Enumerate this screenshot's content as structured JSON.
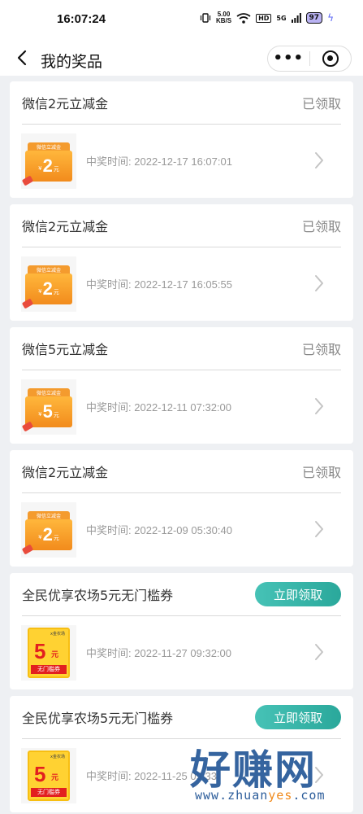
{
  "status_bar": {
    "time": "16:07:24",
    "net_speed_value": "5.00",
    "net_speed_unit": "KB/S",
    "hd": "HD",
    "signal": "5G",
    "battery": "97"
  },
  "nav": {
    "title": "我的奖品",
    "back_icon": "chevron-left-icon",
    "more_icon": "more-dots-icon",
    "close_icon": "target-close-icon"
  },
  "prizes": [
    {
      "name": "微信2元立减金",
      "status": "已领取",
      "action": null,
      "time_label": "中奖时间:",
      "time": "2022-12-17 16:07:01",
      "coupon": {
        "type": "cash",
        "header": "微信立减金",
        "symbol": "¥",
        "amount": "2",
        "unit": "元"
      }
    },
    {
      "name": "微信2元立减金",
      "status": "已领取",
      "action": null,
      "time_label": "中奖时间:",
      "time": "2022-12-17 16:05:55",
      "coupon": {
        "type": "cash",
        "header": "微信立减金",
        "symbol": "¥",
        "amount": "2",
        "unit": "元"
      }
    },
    {
      "name": "微信5元立减金",
      "status": "已领取",
      "action": null,
      "time_label": "中奖时间:",
      "time": "2022-12-11 07:32:00",
      "coupon": {
        "type": "cash",
        "header": "微信立减金",
        "symbol": "¥",
        "amount": "5",
        "unit": "元"
      }
    },
    {
      "name": "微信2元立减金",
      "status": "已领取",
      "action": null,
      "time_label": "中奖时间:",
      "time": "2022-12-09 05:30:40",
      "coupon": {
        "type": "cash",
        "header": "微信立减金",
        "symbol": "¥",
        "amount": "2",
        "unit": "元"
      }
    },
    {
      "name": "全民优享农场5元无门槛券",
      "status": null,
      "action": "立即领取",
      "time_label": "中奖时间:",
      "time": "2022-11-27 09:32:00",
      "coupon": {
        "type": "voucher",
        "header": "x金农场",
        "amount": "5",
        "unit": "元",
        "band": "无门槛券"
      }
    },
    {
      "name": "全民优享农场5元无门槛券",
      "status": null,
      "action": "立即领取",
      "time_label": "中奖时间:",
      "time": "2022-11-25 09:33",
      "coupon": {
        "type": "voucher",
        "header": "x金农场",
        "amount": "5",
        "unit": "元",
        "band": "无门槛券"
      }
    }
  ],
  "watermark": {
    "title": "好赚网",
    "url_prefix": "www.zhuan",
    "url_highlight": "yes",
    "url_suffix": ".com"
  },
  "colors": {
    "claim_button": "#2aa89b",
    "coupon_orange": "#f49b2e",
    "coupon_yellow": "#ffd232",
    "coupon_red": "#e21f1f"
  }
}
